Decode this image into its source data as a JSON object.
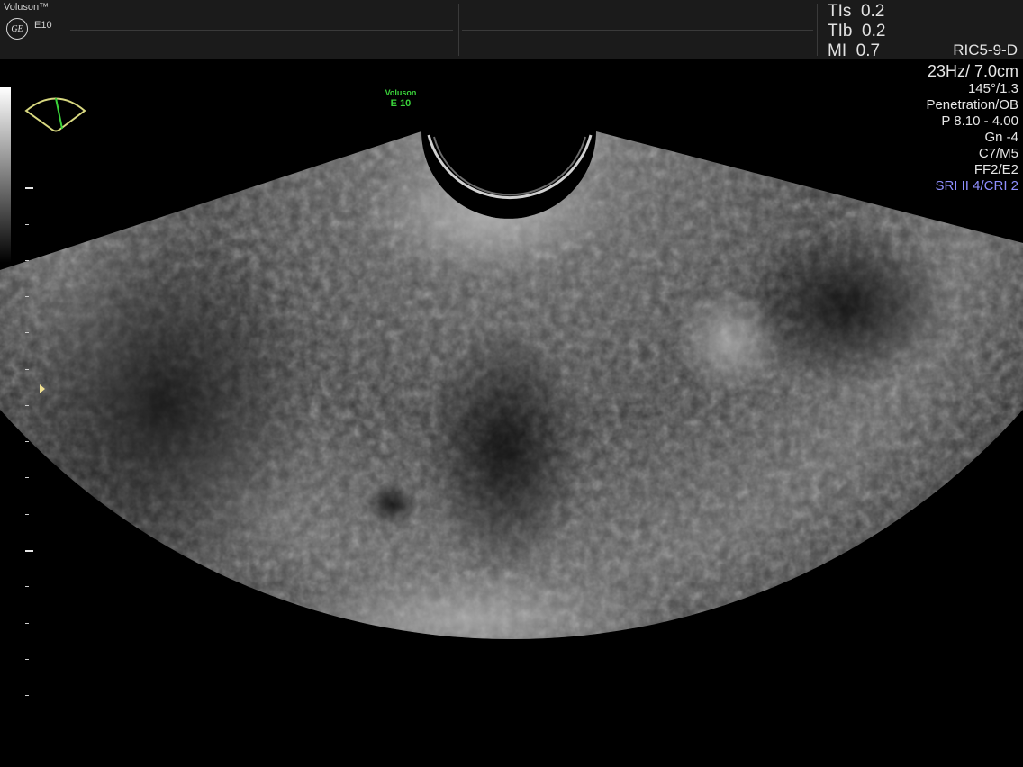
{
  "header": {
    "brand": "Voluson™",
    "logo_text": "GE",
    "model": "E10"
  },
  "safety": {
    "tis": "TIs  0.2",
    "tib": "TIb  0.2",
    "mi": "MI  0.7"
  },
  "probe": "RIC5-9-D",
  "params": {
    "frame_depth": "23Hz/ 7.0cm",
    "angle": "145°/1.3",
    "preset": "Penetration/OB",
    "power": "P 8.10 - 4.00",
    "gain": "Gn  -4",
    "map": "C7/M5",
    "filter": "FF2/E2",
    "sri": "SRI II 4/CRI 2"
  },
  "watermark": {
    "line1": "Voluson",
    "line2": "E 10"
  },
  "colors": {
    "sri_text": "#8f8fff",
    "watermark": "#3ad23a",
    "probe_icon": "#d8d880",
    "focus_marker": "#f0e090"
  }
}
